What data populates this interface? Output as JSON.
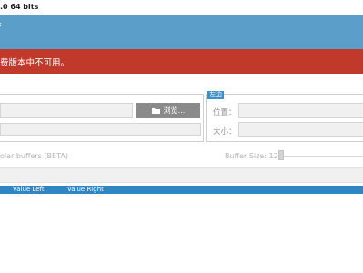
{
  "window": {
    "title": ".0 64 bits"
  },
  "header": {
    "chevron_icon": "chevron-left-icon"
  },
  "error": {
    "message": "费版本中不可用。"
  },
  "left_panel": {
    "browse_label": "浏览...",
    "browse_icon": "folder-icon"
  },
  "right_panel": {
    "legend": "左边",
    "position_label": "位置：",
    "size_label": "大小："
  },
  "options": {
    "buffers_label": "olar buffers (BETA)",
    "buffer_size_label": "Buffer Size: 128"
  },
  "table": {
    "columns": [
      "Value Left",
      "Value Right"
    ]
  },
  "colors": {
    "header_blue": "#5b9ec9",
    "error_red": "#c0392b",
    "table_header_blue": "#2f86c5",
    "button_gray": "#8a8a8a"
  }
}
